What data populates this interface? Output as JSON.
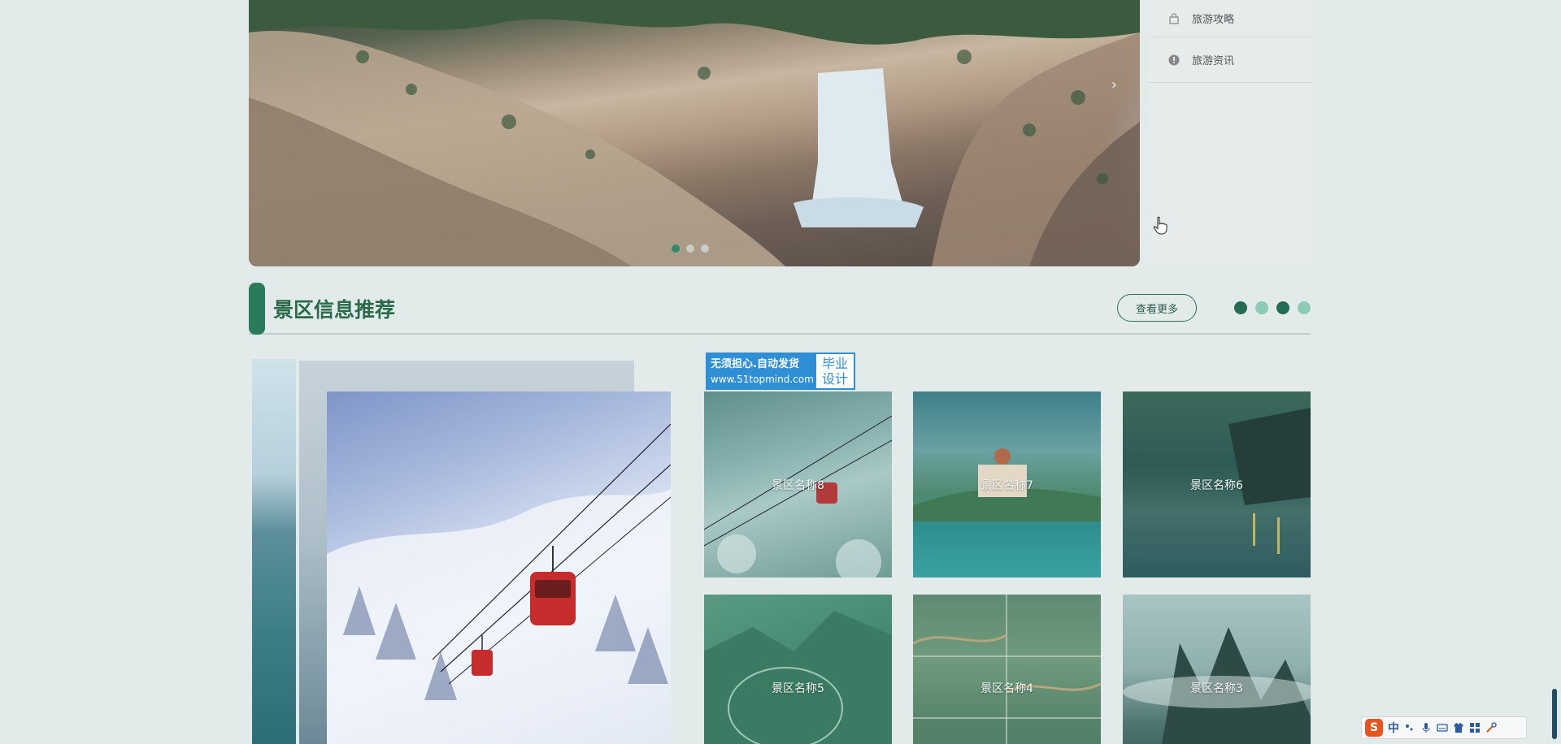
{
  "hero": {
    "arrow": "›",
    "active_dot": 0,
    "dots": [
      0,
      1,
      2
    ]
  },
  "side_menu": {
    "items": [
      {
        "label": "旅游攻略",
        "icon": "shopping-bag-icon"
      },
      {
        "label": "旅游资讯",
        "icon": "info-circle-icon"
      }
    ]
  },
  "section": {
    "title": "景区信息推荐",
    "more_label": "查看更多",
    "dots": [
      "dark",
      "light",
      "dark",
      "light"
    ]
  },
  "badge": {
    "line1": "无须担心.自动发货",
    "line2": "www.51topmind.com",
    "right_line1": "毕业",
    "right_line2": "设计"
  },
  "cards": [
    {
      "label": "景区名称8"
    },
    {
      "label": "景区名称7"
    },
    {
      "label": "景区名称6"
    },
    {
      "label": "景区名称5"
    },
    {
      "label": "景区名称4"
    },
    {
      "label": "景区名称3"
    }
  ],
  "ime": {
    "logo": "S",
    "mode": "中"
  },
  "colors": {
    "accent": "#2a7a5c",
    "title": "#2a6b4c",
    "background": "#e3ebea",
    "badge_blue": "#2e8fd6"
  }
}
